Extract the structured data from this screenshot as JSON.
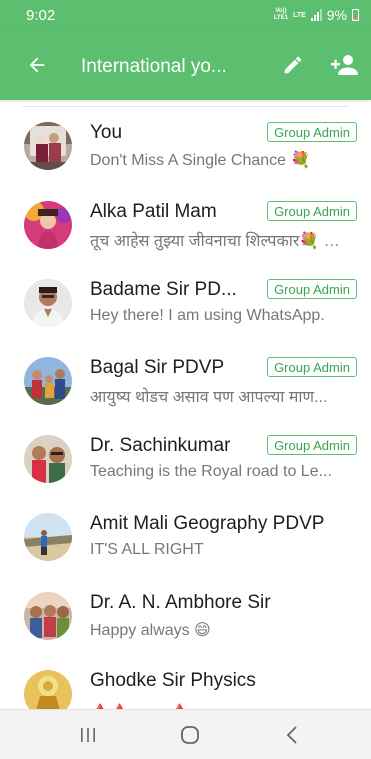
{
  "status_bar": {
    "time": "9:02",
    "volte": "Vo))",
    "lte_top": "LTE",
    "lte_bottom": "LTE1",
    "lte_label": "LTE",
    "battery": "9%"
  },
  "header": {
    "title": "International yo...",
    "back_icon": "arrow-left-icon",
    "edit_icon": "pencil-icon",
    "add_icon": "person-add-icon",
    "color": "#5cbf6f"
  },
  "participants": [
    {
      "name": "You",
      "status": "Don't Miss A Single Chance 💐",
      "admin": "Group Admin"
    },
    {
      "name": "Alka Patil Mam",
      "status": "तूच आहेस तुझ्या जीवनाचा शिल्पकार💐 …",
      "admin": "Group Admin"
    },
    {
      "name": "Badame Sir PD...",
      "status": "Hey there! I am using WhatsApp.",
      "admin": "Group Admin"
    },
    {
      "name": "Bagal Sir PDVP",
      "status": "आयुष्य थोडच असाव पण आपल्या माण...",
      "admin": "Group Admin"
    },
    {
      "name": "Dr. Sachinkumar",
      "status": "Teaching is the Royal road to Le...",
      "admin": "Group Admin"
    },
    {
      "name": "Amit Mali Geography PDVP",
      "status": "IT'S ALL RIGHT",
      "admin": ""
    },
    {
      "name": "Dr. A. N. Ambhore Sir",
      "status": "Happy always 😄",
      "admin": ""
    },
    {
      "name": "Ghodke Sir Physics",
      "status": "🔺🔺 ....... 🔺",
      "admin": ""
    }
  ],
  "nav": {
    "recents_icon": "recents-icon",
    "home_icon": "home-icon",
    "back_icon": "nav-back-icon"
  },
  "colors": {
    "accent": "#5cbf6f",
    "badge_text": "#37a552"
  }
}
